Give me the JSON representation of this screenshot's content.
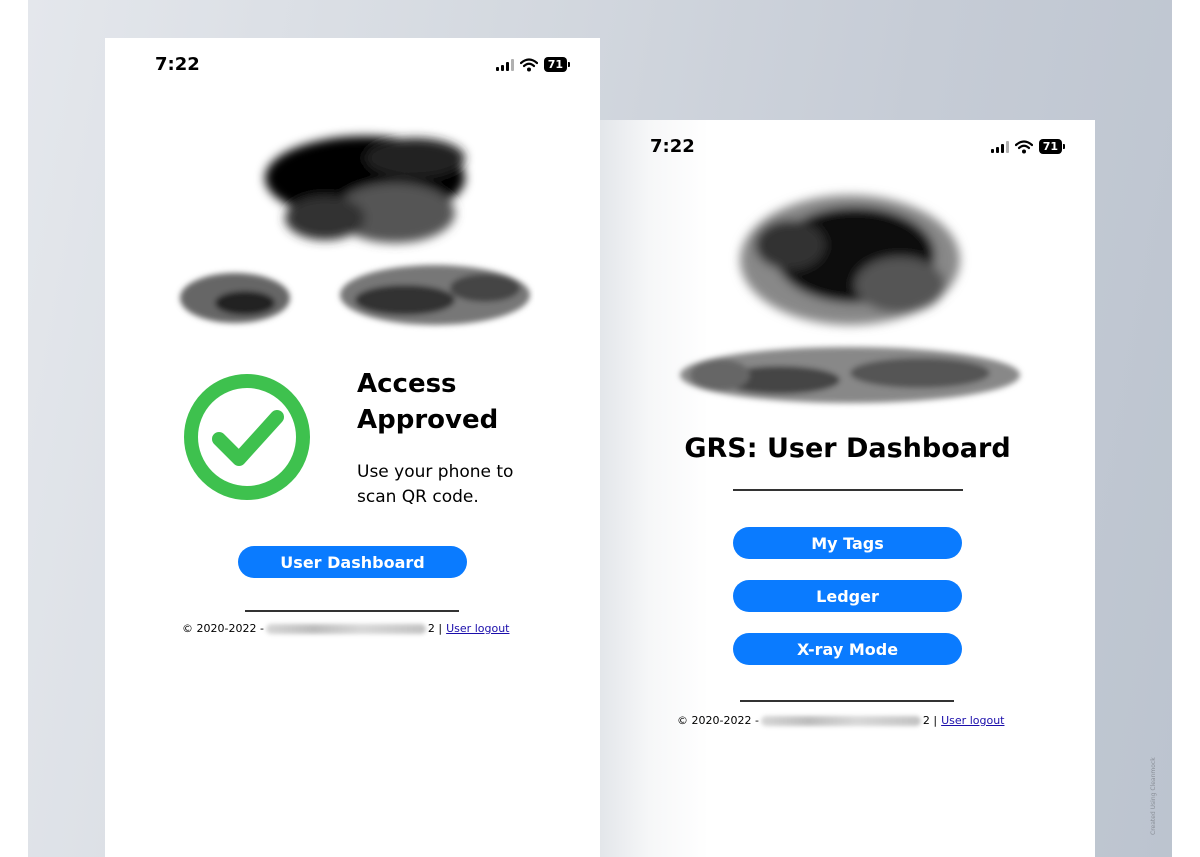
{
  "status_bar": {
    "time": "7:22",
    "battery_level": "71",
    "icons": [
      "cellular-signal-icon",
      "wifi-icon",
      "battery-icon"
    ]
  },
  "access_screen": {
    "status_icon": "checkmark-circle-icon",
    "title_line1": "Access",
    "title_line2": "Approved",
    "subtitle": "Use your phone to scan QR code.",
    "dashboard_button": "User Dashboard",
    "footer": {
      "copyright": "© 2020-2022 -",
      "suffix": "2 |",
      "logout_link": "User logout"
    }
  },
  "dashboard_screen": {
    "title": "GRS: User Dashboard",
    "buttons": [
      "My Tags",
      "Ledger",
      "X-ray Mode"
    ],
    "footer": {
      "copyright": "© 2020-2022 -",
      "suffix": "2 |",
      "logout_link": "User logout"
    }
  },
  "watermark": "Created Using Cleanmock",
  "colors": {
    "accent": "#0a7bff",
    "success": "#3ec14e",
    "backdrop": "#c6ccd6"
  }
}
